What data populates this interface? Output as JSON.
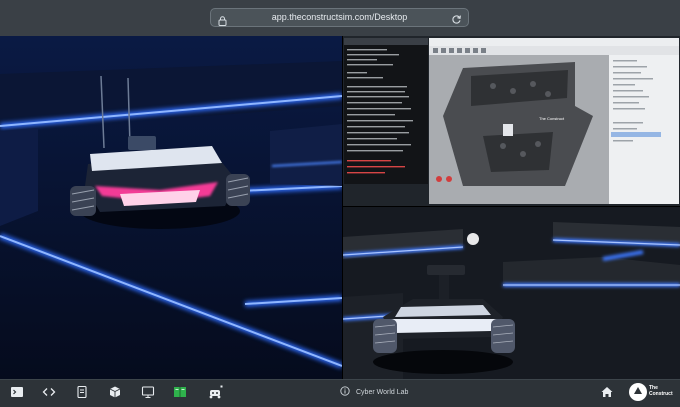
{
  "browser": {
    "url": "app.theconstructsim.com/Desktop"
  },
  "scene": {
    "brand_logo_label": "The Construct",
    "terminal_line": "rosrun turtlebot teleop keyboard"
  },
  "status": {
    "label": "Cyber World Lab"
  },
  "toolbar": {
    "items": [
      "terminal-icon",
      "code-icon",
      "notebook-icon",
      "cube-icon",
      "monitor-icon",
      "book-icon",
      "robot-icon"
    ]
  },
  "brand": {
    "line1": "The",
    "line2": "Construct"
  }
}
